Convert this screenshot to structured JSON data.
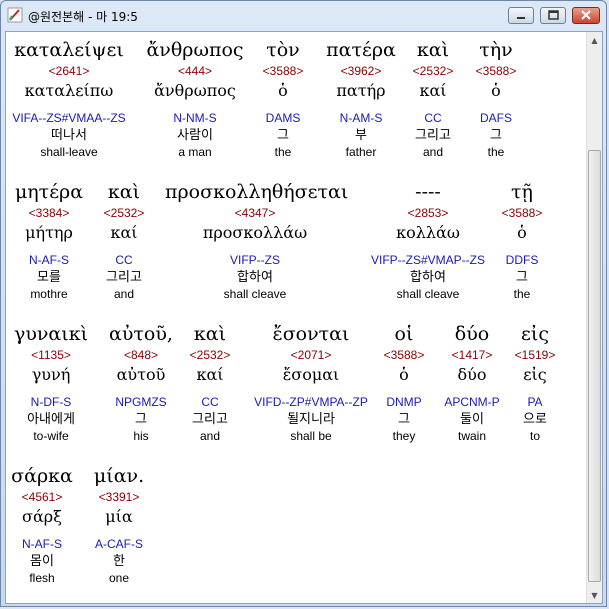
{
  "window": {
    "title": "@원전본해 - 마 19:5"
  },
  "colors": {
    "strong_number": "#8b0000",
    "parsing": "#1a1ab0"
  },
  "rows": [
    [
      {
        "greek": "καταλείψει",
        "num": "<2641>",
        "lemma": "καταλείπω",
        "parse": "VIFA--ZS#VMAA--ZS",
        "korean": "떠나서",
        "english": "shall-leave"
      },
      {
        "greek": "ἄνθρωπος",
        "num": "<444>",
        "lemma": "ἄνθρωπος",
        "parse": "N-NM-S",
        "korean": "사람이",
        "english": "a man"
      },
      {
        "greek": "τὸν",
        "num": "<3588>",
        "lemma": "ὁ",
        "parse": "DAMS",
        "korean": "그",
        "english": "the"
      },
      {
        "greek": "πατέρα",
        "num": "<3962>",
        "lemma": "πατήρ",
        "parse": "N-AM-S",
        "korean": "부",
        "english": "father"
      },
      {
        "greek": "καὶ",
        "num": "<2532>",
        "lemma": "καί",
        "parse": "CC",
        "korean": "그리고",
        "english": "and"
      },
      {
        "greek": "τὴν",
        "num": "<3588>",
        "lemma": "ὁ",
        "parse": "DAFS",
        "korean": "그",
        "english": "the"
      }
    ],
    [
      {
        "greek": "μητέρα",
        "num": "<3384>",
        "lemma": "μήτηρ",
        "parse": "N-AF-S",
        "korean": "모를",
        "english": "mothre"
      },
      {
        "greek": "καὶ",
        "num": "<2532>",
        "lemma": "καί",
        "parse": "CC",
        "korean": "그리고",
        "english": "and"
      },
      {
        "greek": "προσκολληθήσεται",
        "num": "<4347>",
        "lemma": "προσκολλάω",
        "parse": "VIFP--ZS",
        "korean": "합하여",
        "english": "shall cleave"
      },
      {
        "greek": "----",
        "num": "<2853>",
        "lemma": "κολλάω",
        "parse": "VIFP--ZS#VMAP--ZS",
        "korean": "합하여",
        "english": "shall cleave"
      },
      {
        "greek": "τῇ",
        "num": "<3588>",
        "lemma": "ὁ",
        "parse": "DDFS",
        "korean": "그",
        "english": "the"
      }
    ],
    [
      {
        "greek": "γυναικὶ",
        "num": "<1135>",
        "lemma": "γυνή",
        "parse": "N-DF-S",
        "korean": "아내에게",
        "english": "to-wife"
      },
      {
        "greek": "αὐτοῦ,",
        "num": "<848>",
        "lemma": "αὐτοῦ",
        "parse": "NPGMZS",
        "korean": "그",
        "english": "his"
      },
      {
        "greek": "καὶ",
        "num": "<2532>",
        "lemma": "καί",
        "parse": "CC",
        "korean": "그리고",
        "english": "and"
      },
      {
        "greek": "ἔσονται",
        "num": "<2071>",
        "lemma": "ἔσομαι",
        "parse": "VIFD--ZP#VMPA--ZP",
        "korean": "될지니라",
        "english": "shall be"
      },
      {
        "greek": "οἱ",
        "num": "<3588>",
        "lemma": "ὁ",
        "parse": "DNMP",
        "korean": "그",
        "english": "they"
      },
      {
        "greek": "δύο",
        "num": "<1417>",
        "lemma": "δύο",
        "parse": "APCNM-P",
        "korean": "둘이",
        "english": "twain"
      },
      {
        "greek": "εἰς",
        "num": "<1519>",
        "lemma": "εἰς",
        "parse": "PA",
        "korean": "으로",
        "english": "to"
      }
    ],
    [
      {
        "greek": "σάρκα",
        "num": "<4561>",
        "lemma": "σάρξ",
        "parse": "N-AF-S",
        "korean": "몸이",
        "english": "flesh"
      },
      {
        "greek": "μίαν.",
        "num": "<3391>",
        "lemma": "μία",
        "parse": "A-CAF-S",
        "korean": "한",
        "english": "one"
      }
    ]
  ]
}
